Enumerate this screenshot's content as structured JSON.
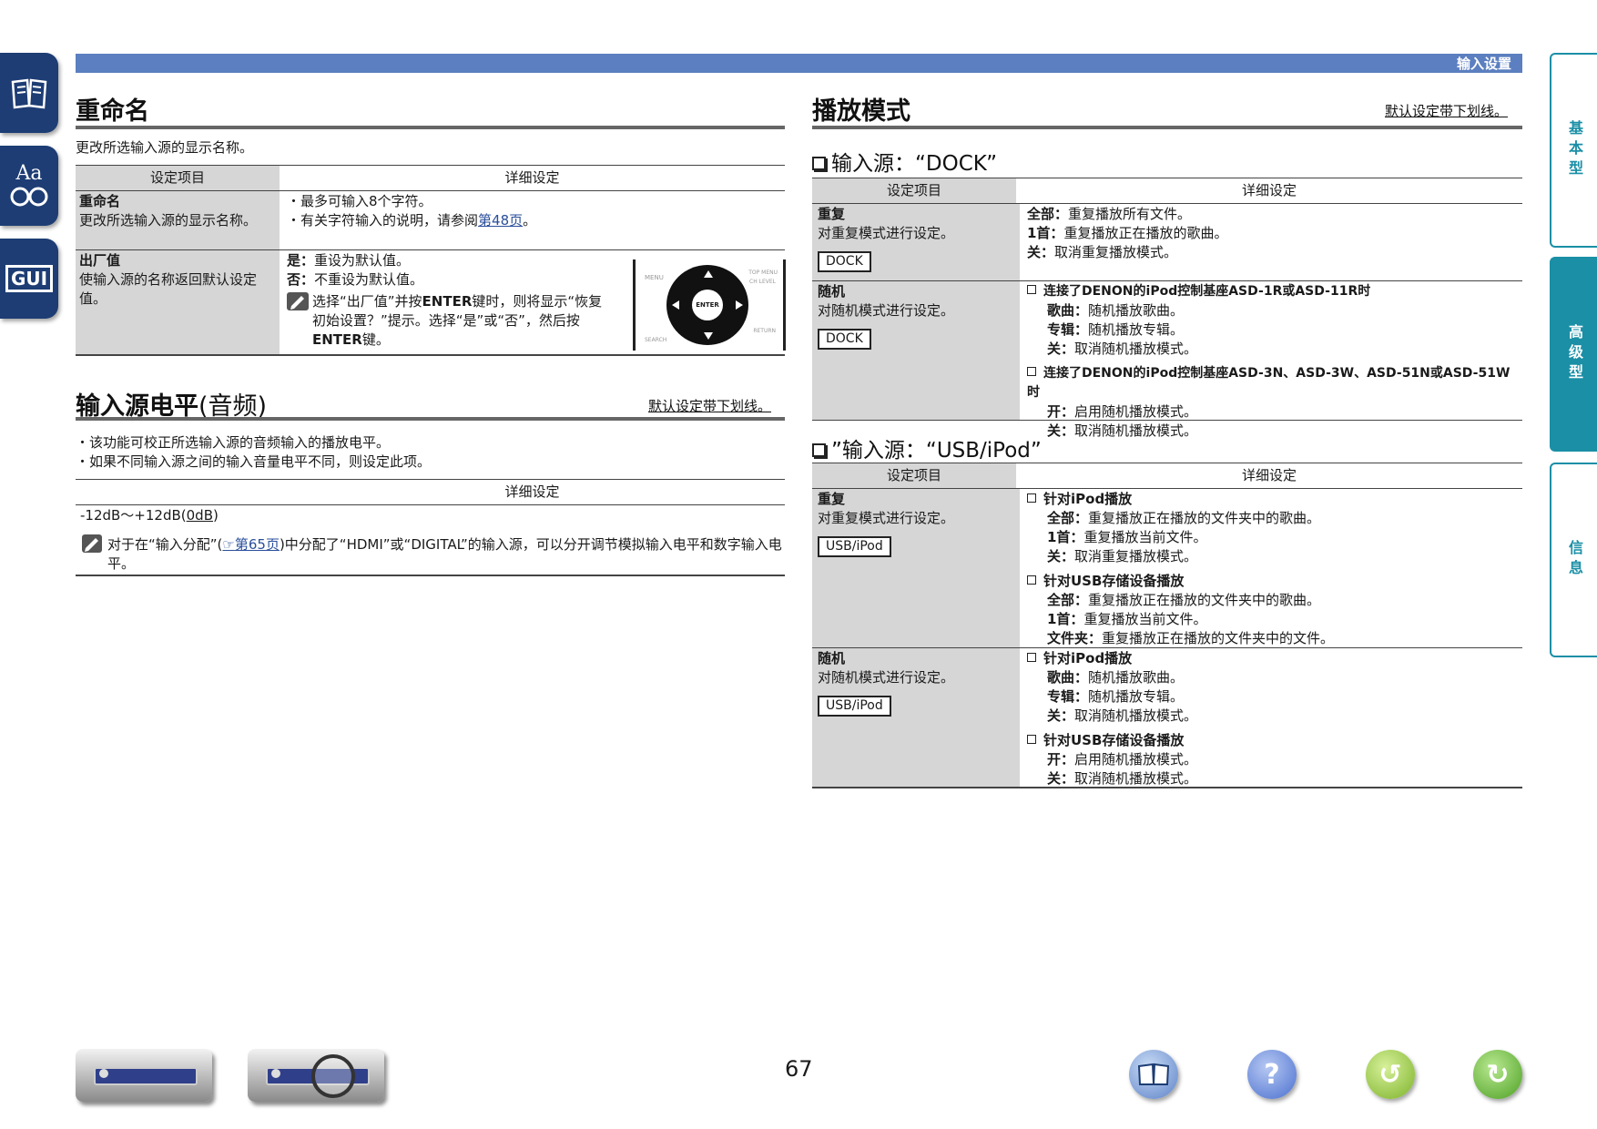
{
  "header": {
    "section": "输入设置"
  },
  "side_nav": {
    "gui_label": "GUI",
    "aa_label": "Aa"
  },
  "side_tabs": [
    {
      "label": "基本型"
    },
    {
      "label": "高级型"
    },
    {
      "label": "信息"
    }
  ],
  "rename": {
    "title": "重命名",
    "description": "更改所选输入源的显示名称。",
    "col_item": "设定项目",
    "col_detail": "详细设定",
    "row1": {
      "name": "重命名",
      "desc": "更改所选输入源的显示名称。",
      "bullet1": "最多可输入8个字符。",
      "bullet2_prefix": "有关字符输入的说明，请参阅",
      "bullet2_link": "第48页",
      "bullet2_suffix": "。"
    },
    "row2": {
      "name": "出厂值",
      "desc": "使输入源的名称返回默认设定值。",
      "yes_key": "是：",
      "yes_val": "重设为默认值。",
      "no_key": "否：",
      "no_val": "不重设为默认值。",
      "note_a": "选择“出厂值”并按",
      "note_b": "ENTER",
      "note_c": "键时，则将显示“恢复初始设置？”提示。选择“是”或“否”，然后按",
      "note_d": "ENTER",
      "note_e": "键。"
    },
    "remote": {
      "enter": "ENTER",
      "menu": "MENU",
      "top_menu": "TOP MENU",
      "ch_level": "CH LEVEL",
      "search": "SEARCH",
      "return": "RETURN"
    }
  },
  "level": {
    "title_bold": "输入源电平",
    "title_rest": "(音频)",
    "default_note": "默认设定带下划线。",
    "bullet1": "该功能可校正所选输入源的音频输入的播放电平。",
    "bullet2": "如果不同输入源之间的输入音量电平不同，则设定此项。",
    "col_detail": "详细设定",
    "range_prefix": "-12dB～+12dB(",
    "range_default": "0dB",
    "range_suffix": ")",
    "note_prefix": "对于在“输入分配”(",
    "note_link": "第65页",
    "note_suffix": ")中分配了“HDMI”或“DIGITAL”的输入源，可以分开调节模拟输入电平和数字输入电平。"
  },
  "play_mode": {
    "title": "播放模式",
    "default_note": "默认设定带下划线。",
    "dock_heading": "输入源：“DOCK”",
    "usb_heading": "”输入源：“USB/iPod”",
    "col_item": "设定项目",
    "col_detail": "详细设定",
    "dock": {
      "repeat_name": "重复",
      "repeat_desc": "对重复模式进行设定。",
      "repeat_tag": "DOCK",
      "repeat_lines": [
        {
          "k": "全部：",
          "v": "重复播放所有文件。"
        },
        {
          "k": "1首：",
          "v": "重复播放正在播放的歌曲。"
        },
        {
          "k": "关：",
          "v": "取消重复播放模式。"
        }
      ],
      "random_name": "随机",
      "random_desc": "对随机模式进行设定。",
      "random_tag": "DOCK",
      "group1_title": "连接了DENON的iPod控制基座ASD-1R或ASD-11R时",
      "group1_lines": [
        {
          "k": "歌曲：",
          "v": "随机播放歌曲。"
        },
        {
          "k": "专辑：",
          "v": "随机播放专辑。"
        },
        {
          "k": "关：",
          "v": "取消随机播放模式。"
        }
      ],
      "group2_title": "连接了DENON的iPod控制基座ASD-3N、ASD-3W、ASD-51N或ASD-51W时",
      "group2_lines": [
        {
          "k": "开：",
          "v": "启用随机播放模式。"
        },
        {
          "k": "关：",
          "v": "取消随机播放模式。"
        }
      ]
    },
    "usb": {
      "repeat_name": "重复",
      "repeat_desc": "对重复模式进行设定。",
      "repeat_tag": "USB/iPod",
      "r_ipod_title": "针对iPod播放",
      "r_ipod_lines": [
        {
          "k": "全部：",
          "v": "重复播放正在播放的文件夹中的歌曲。"
        },
        {
          "k": "1首：",
          "v": "重复播放当前文件。"
        },
        {
          "k": "关：",
          "v": "取消重复播放模式。"
        }
      ],
      "r_usb_title": "针对USB存储设备播放",
      "r_usb_lines": [
        {
          "k": "全部：",
          "v": "重复播放正在播放的文件夹中的歌曲。"
        },
        {
          "k": "1首：",
          "v": "重复播放当前文件。"
        },
        {
          "k": "文件夹：",
          "v": "重复播放正在播放的文件夹中的文件。"
        }
      ],
      "random_name": "随机",
      "random_desc": "对随机模式进行设定。",
      "random_tag": "USB/iPod",
      "s_ipod_title": "针对iPod播放",
      "s_ipod_lines": [
        {
          "k": "歌曲：",
          "v": "随机播放歌曲。"
        },
        {
          "k": "专辑：",
          "v": "随机播放专辑。"
        },
        {
          "k": "关：",
          "v": "取消随机播放模式。"
        }
      ],
      "s_usb_title": "针对USB存储设备播放",
      "s_usb_lines": [
        {
          "k": "开：",
          "v": "启用随机播放模式。"
        },
        {
          "k": "关：",
          "v": "取消随机播放模式。"
        }
      ]
    }
  },
  "page_number": "67",
  "colors": {
    "header_bar": "#5b7fc0",
    "nav_dark": "#1d3d74",
    "tab_teal": "#1a8fa6",
    "table_gray": "#d6d6d6"
  },
  "bottom_icons": [
    "receiver-front-icon",
    "receiver-zoom-icon",
    "book-icon",
    "help-icon",
    "back-icon",
    "forward-icon"
  ]
}
